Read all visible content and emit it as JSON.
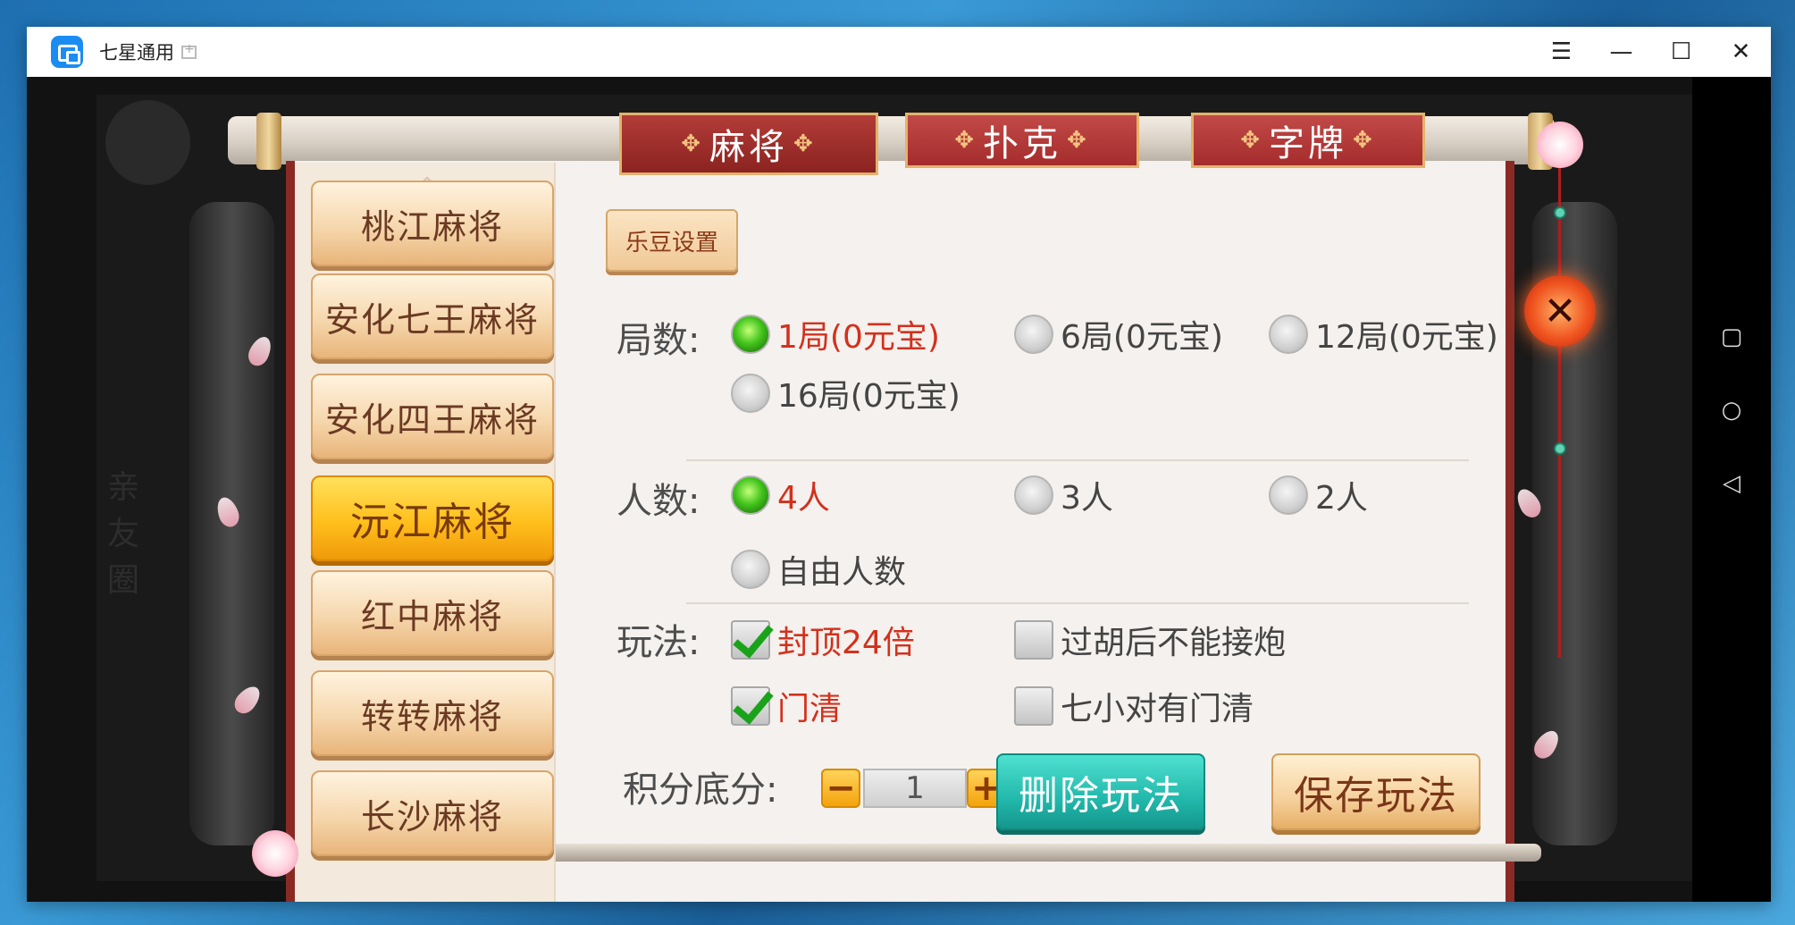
{
  "window": {
    "title": "七星通用"
  },
  "tabs": [
    {
      "label": "麻将",
      "active": true
    },
    {
      "label": "扑克",
      "active": false
    },
    {
      "label": "字牌",
      "active": false
    }
  ],
  "game_list": [
    {
      "label": "桃江麻将",
      "active": false
    },
    {
      "label": "安化七王麻将",
      "active": false
    },
    {
      "label": "安化四王麻将",
      "active": false
    },
    {
      "label": "沅江麻将",
      "active": true
    },
    {
      "label": "红中麻将",
      "active": false
    },
    {
      "label": "转转麻将",
      "active": false
    },
    {
      "label": "长沙麻将",
      "active": false
    }
  ],
  "ledou_button": "乐豆设置",
  "rounds": {
    "label": "局数:",
    "options": [
      {
        "label": "1局(0元宝)",
        "selected": true
      },
      {
        "label": "6局(0元宝)",
        "selected": false
      },
      {
        "label": "12局(0元宝)",
        "selected": false
      },
      {
        "label": "16局(0元宝)",
        "selected": false
      }
    ]
  },
  "players": {
    "label": "人数:",
    "options": [
      {
        "label": "4人",
        "selected": true
      },
      {
        "label": "3人",
        "selected": false
      },
      {
        "label": "2人",
        "selected": false
      },
      {
        "label": "自由人数",
        "selected": false
      }
    ]
  },
  "rules": {
    "label": "玩法:",
    "options": [
      {
        "label": "封顶24倍",
        "checked": true
      },
      {
        "label": "过胡后不能接炮",
        "checked": false
      },
      {
        "label": "门清",
        "checked": true
      },
      {
        "label": "七小对有门清",
        "checked": false
      }
    ]
  },
  "score": {
    "label": "积分底分:",
    "value": "1",
    "minus": "−",
    "plus": "+"
  },
  "delete_button": "删除玩法",
  "save_button": "保存玩法",
  "colors": {
    "accent_red": "#d2311d",
    "tab_red": "#a52c2c",
    "active_gold": "#ffbf1c",
    "teal": "#22b8ab"
  }
}
